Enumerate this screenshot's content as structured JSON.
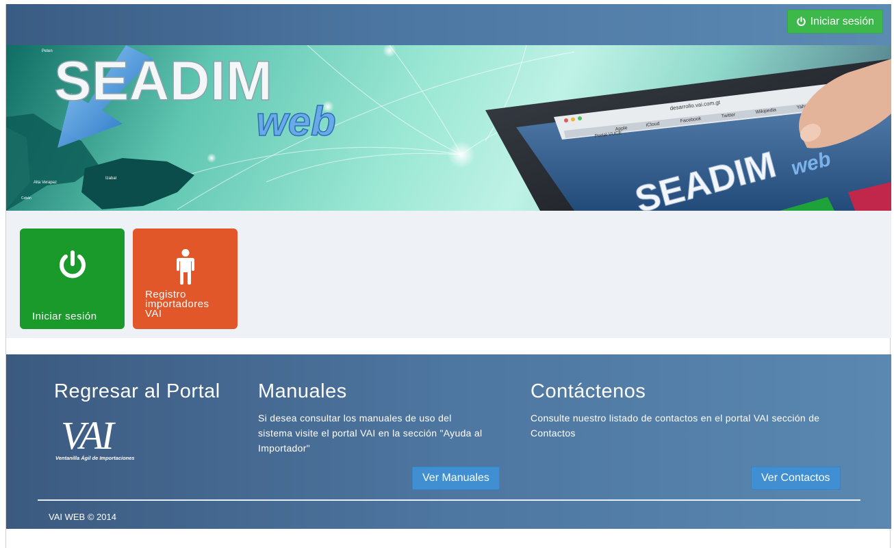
{
  "navbar": {
    "login_button_label": "Iniciar sesión",
    "login_button_color": "#3cb94a"
  },
  "banner": {
    "logo_main": "SEADIM",
    "logo_sub": "web",
    "browser_url": "desarrollo.vai.com.gt",
    "browser_tabs": [
      "Apple",
      "iCloud",
      "Facebook",
      "Twitter",
      "Wikipedia",
      "Yahoo"
    ],
    "browser_bookmark": "Portal VUCE",
    "screen_logo_main": "SEADIM",
    "screen_logo_sub": "web",
    "map_labels": [
      "Peten",
      "Alta Verapaz",
      "Izabal",
      "Cobán"
    ]
  },
  "tiles": [
    {
      "label": "Iniciar sesión",
      "icon": "power-icon",
      "color": "#1b9a2c"
    },
    {
      "label_lines": [
        "Registro",
        "importadores",
        "VAI"
      ],
      "icon": "person-icon",
      "color": "#e1572a"
    }
  ],
  "footer": {
    "portal": {
      "title": "Regresar al Portal",
      "logo_text": "VAI",
      "logo_caption": "Ventanilla Ágil de Importaciones"
    },
    "manuals": {
      "title": "Manuales",
      "text_lines": [
        "Si desea consultar los manuales de uso del",
        "sistema visite el portal VAI en la sección \"Ayuda al",
        "Importador\""
      ],
      "button_label": "Ver Manuales"
    },
    "contact": {
      "title": "Contáctenos",
      "text_lines": [
        "Consulte nuestro listado de contactos en el portal VAI sección de",
        "Contactos"
      ],
      "button_label": "Ver Contactos"
    },
    "copyright": "VAI WEB © 2014"
  }
}
